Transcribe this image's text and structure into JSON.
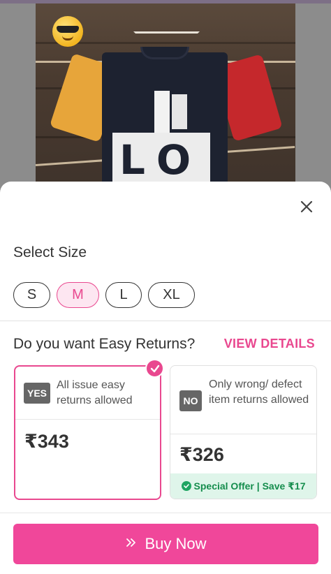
{
  "size_selector": {
    "title": "Select Size",
    "sizes": [
      "S",
      "M",
      "L",
      "XL"
    ],
    "selected": "M"
  },
  "returns": {
    "question": "Do you want Easy Returns?",
    "view_details": "VIEW DETAILS",
    "options": [
      {
        "badge": "YES",
        "description": "All issue easy returns allowed",
        "price": "₹343",
        "selected": true
      },
      {
        "badge": "NO",
        "description": "Only wrong/ defect item returns allowed",
        "price": "₹326",
        "offer": "Special Offer | Save ₹17",
        "selected": false
      }
    ]
  },
  "actions": {
    "buy_now": "Buy Now"
  },
  "product_image": {
    "print_text": "LO"
  },
  "colors": {
    "accent": "#e9488f",
    "button": "#f0479a",
    "offer_bg": "#dff5ea",
    "offer_text": "#158d4d"
  },
  "icons": {
    "close": "close-icon",
    "check": "check-icon",
    "offer": "offer-badge-icon",
    "buy": "double-chevron-right-icon"
  }
}
